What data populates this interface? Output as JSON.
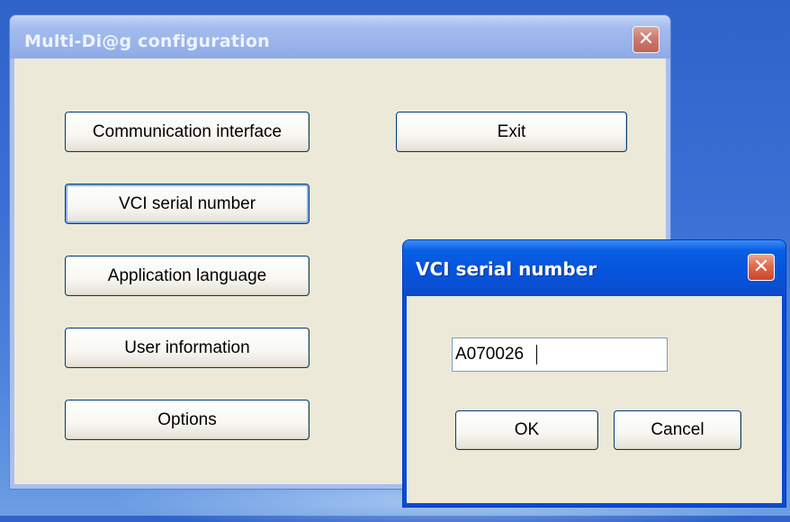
{
  "main_window": {
    "title": "Multi-Di@g configuration",
    "close_label": "✕",
    "buttons": {
      "communication_interface": "Communication interface",
      "vci_serial_number": "VCI serial number",
      "application_language": "Application language",
      "user_information": "User information",
      "options": "Options",
      "exit": "Exit"
    }
  },
  "dialog": {
    "title": "VCI serial number",
    "close_label": "✕",
    "serial_value": "A070026",
    "ok_label": "OK",
    "cancel_label": "Cancel"
  }
}
